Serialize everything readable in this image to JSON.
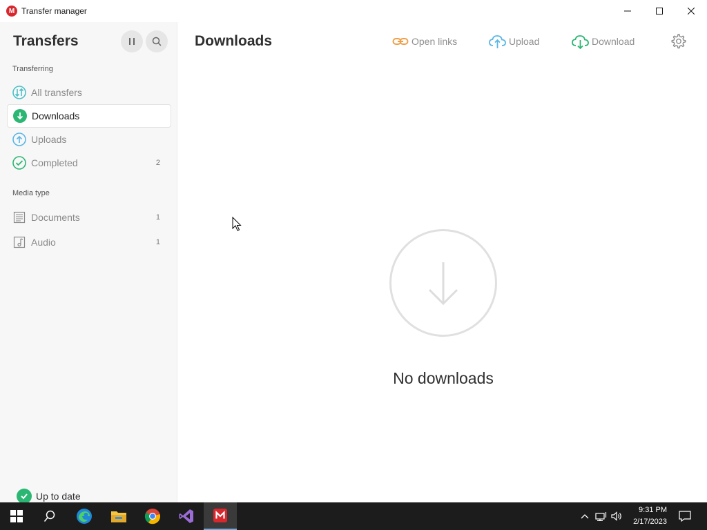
{
  "window": {
    "title": "Transfer manager",
    "app_icon_letter": "M"
  },
  "sidebar": {
    "heading": "Transfers",
    "sections": {
      "transferring_label": "Transferring",
      "media_type_label": "Media type"
    },
    "items": [
      {
        "label": "All transfers",
        "icon": "all-transfers-icon",
        "count": ""
      },
      {
        "label": "Downloads",
        "icon": "download-circle-icon",
        "count": "",
        "active": true
      },
      {
        "label": "Uploads",
        "icon": "upload-circle-icon",
        "count": ""
      },
      {
        "label": "Completed",
        "icon": "check-circle-icon",
        "count": "2"
      }
    ],
    "media": [
      {
        "label": "Documents",
        "icon": "document-icon",
        "count": "1"
      },
      {
        "label": "Audio",
        "icon": "audio-icon",
        "count": "1"
      }
    ],
    "status": "Up to date"
  },
  "main": {
    "title": "Downloads",
    "toolbar": {
      "open_links": "Open links",
      "upload": "Upload",
      "download": "Download"
    },
    "empty_message": "No downloads"
  },
  "taskbar": {
    "time": "9:31 PM",
    "date": "2/17/2023"
  },
  "colors": {
    "brand_red": "#d9272e",
    "accent_green": "#2bb673",
    "accent_teal": "#4bc0c8",
    "open_links_orange": "#f0a04b",
    "upload_blue": "#59b6e6"
  }
}
